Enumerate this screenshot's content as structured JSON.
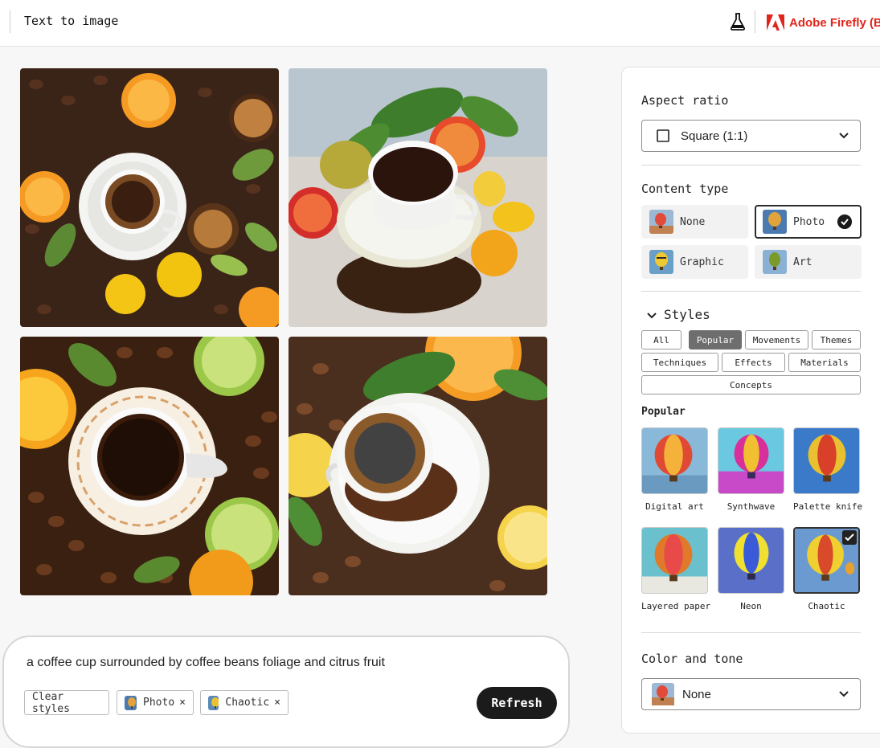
{
  "header": {
    "title": "Text to image",
    "brand": "Adobe Firefly (Be"
  },
  "colors": {
    "brand_red": "#e1251b",
    "selected_border": "#2c2c2c",
    "active_pill": "#6e6e6e",
    "refresh_bg": "#1b1b1b"
  },
  "prompt": {
    "text": "a coffee cup surrounded by coffee beans foliage and citrus fruit",
    "chips": [
      {
        "label": "Clear styles"
      },
      {
        "label": "Photo",
        "remove": "×"
      },
      {
        "label": "Chaotic",
        "remove": "×"
      }
    ],
    "refresh_label": "Refresh"
  },
  "panel": {
    "aspect": {
      "label": "Aspect ratio",
      "value": "Square (1:1)"
    },
    "content_type": {
      "label": "Content type",
      "options": [
        "None",
        "Photo",
        "Graphic",
        "Art"
      ],
      "selected": "Photo"
    },
    "styles": {
      "label": "Styles",
      "filters": [
        "All",
        "Popular",
        "Movements",
        "Themes",
        "Techniques",
        "Effects",
        "Materials",
        "Concepts"
      ],
      "active_filter": "Popular",
      "section_label": "Popular",
      "tiles": [
        "Digital art",
        "Synthwave",
        "Palette knife",
        "Layered paper",
        "Neon",
        "Chaotic"
      ],
      "selected_tile": "Chaotic"
    },
    "color_tone": {
      "label": "Color and tone",
      "value": "None"
    }
  },
  "icons": [
    "flask-icon",
    "adobe-logo-icon",
    "chevron-down-icon",
    "square-icon",
    "check-icon",
    "close-icon",
    "balloon-thumbnail-icon"
  ]
}
